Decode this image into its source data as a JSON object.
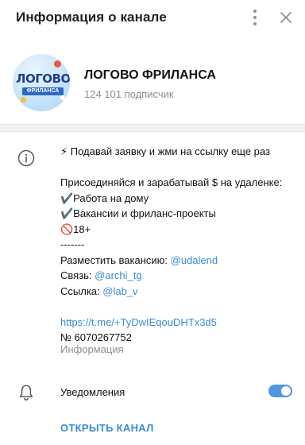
{
  "header": {
    "title": "Информация о канале",
    "menu_icon": "more-vertical-icon",
    "close_icon": "close-icon"
  },
  "channel": {
    "avatar_text": "ЛОГОВО",
    "avatar_ribbon": "ФРИЛАНСА",
    "name": "ЛОГОВО ФРИЛАНСА",
    "subscribers": "124 101 подписчик"
  },
  "description": {
    "icon": "info-icon",
    "lines": [
      {
        "prefix": "⚡ Подавай заявку и жми на ссылку еще раз",
        "link": ""
      },
      {
        "prefix": "",
        "link": ""
      },
      {
        "prefix": "Присоединяйся и зарабатывай $ на удаленке:",
        "link": ""
      },
      {
        "prefix": "✔️Работа на дому",
        "link": ""
      },
      {
        "prefix": "✔️Вакансии и фриланс-проекты",
        "link": ""
      },
      {
        "prefix": "🚫18+",
        "link": ""
      },
      {
        "prefix": "-------",
        "link": ""
      },
      {
        "prefix": "Разместить вакансию: ",
        "link": "@udalend"
      },
      {
        "prefix": "Связь: ",
        "link": "@archi_tg"
      },
      {
        "prefix": "Ссылка: ",
        "link": "@lab_v"
      },
      {
        "prefix": "",
        "link": ""
      },
      {
        "prefix": "",
        "link": "https://t.me/+TyDwIEqouDHTx3d5"
      },
      {
        "prefix": "№ 6070267752",
        "link": ""
      }
    ],
    "caption": "Информация"
  },
  "notifications": {
    "icon": "bell-icon",
    "label": "Уведомления",
    "enabled": true
  },
  "actions": {
    "open_channel": "ОТКРЫТЬ КАНАЛ"
  },
  "colors": {
    "accent": "#3a8bd6",
    "toggle_on": "#4d98de",
    "secondary_text": "#8b9096"
  }
}
